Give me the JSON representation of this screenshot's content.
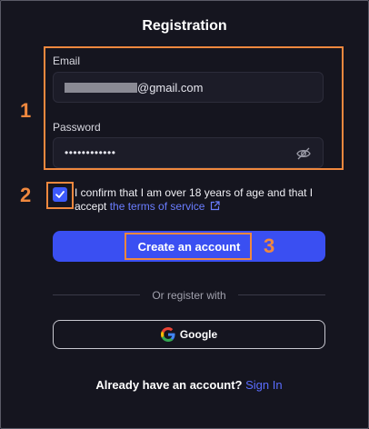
{
  "form": {
    "title": "Registration",
    "email": {
      "label": "Email",
      "value_suffix": "@gmail.com"
    },
    "password": {
      "label": "Password",
      "value_masked": "••••••••••••"
    },
    "consent": {
      "text": "I confirm that I am over 18 years of age and that I accept",
      "link_text": "the terms of service",
      "checked": true
    },
    "submit_label": "Create an account",
    "divider_text": "Or register with",
    "google_label": "Google",
    "signin_prompt": "Already have an account?",
    "signin_link": "Sign In"
  },
  "annotations": {
    "step1": "1",
    "step2": "2",
    "step3": "3"
  },
  "colors": {
    "background": "#14141f",
    "accent": "#3a4ff2",
    "link": "#5a6dff",
    "annotation": "#f0883e"
  }
}
